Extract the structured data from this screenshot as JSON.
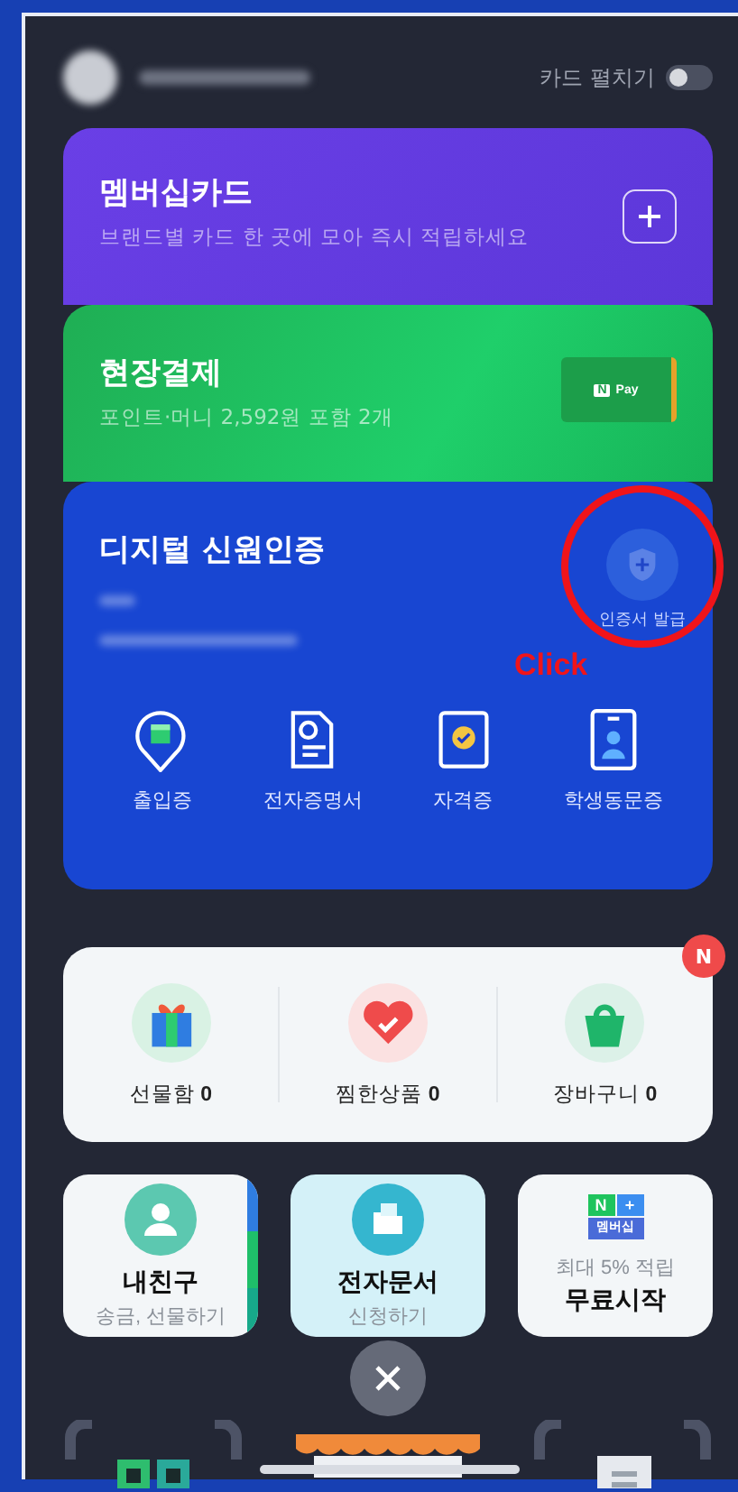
{
  "header": {
    "toggle_label": "카드 펼치기",
    "toggle_on": false
  },
  "cards": [
    {
      "kind": "membership",
      "title": "멤버십카드",
      "subtitle": "브랜드별 카드 한 곳에 모아 즉시 적립하세요"
    },
    {
      "kind": "payment",
      "title": "현장결제",
      "subtitle": "포인트·머니 2,592원 포함 2개",
      "pay_mark": "N",
      "pay_label": "Pay"
    },
    {
      "kind": "identity",
      "title": "디지털 신원인증",
      "action_label": "인증서 발급",
      "annotation": "Click",
      "items": [
        {
          "kind": "entry",
          "label": "출입증"
        },
        {
          "kind": "certificate",
          "label": "전자증명서"
        },
        {
          "kind": "license",
          "label": "자격증"
        },
        {
          "kind": "student",
          "label": "학생동문증"
        }
      ]
    }
  ],
  "quick_menu": {
    "badge": "N",
    "items": [
      {
        "kind": "gift",
        "label": "선물함",
        "count": "0"
      },
      {
        "kind": "wish",
        "label": "찜한상품",
        "count": "0"
      },
      {
        "kind": "cart",
        "label": "장바구니",
        "count": "0"
      }
    ]
  },
  "tiles": [
    {
      "kind": "friend",
      "title": "내친구",
      "subtitle": "송금, 선물하기"
    },
    {
      "kind": "document",
      "title": "전자문서",
      "subtitle": "신청하기"
    },
    {
      "kind": "plus",
      "logo": [
        "N",
        "+",
        "멤버십"
      ],
      "subtitle": "최대 5% 적립",
      "title": "무료시작"
    }
  ]
}
